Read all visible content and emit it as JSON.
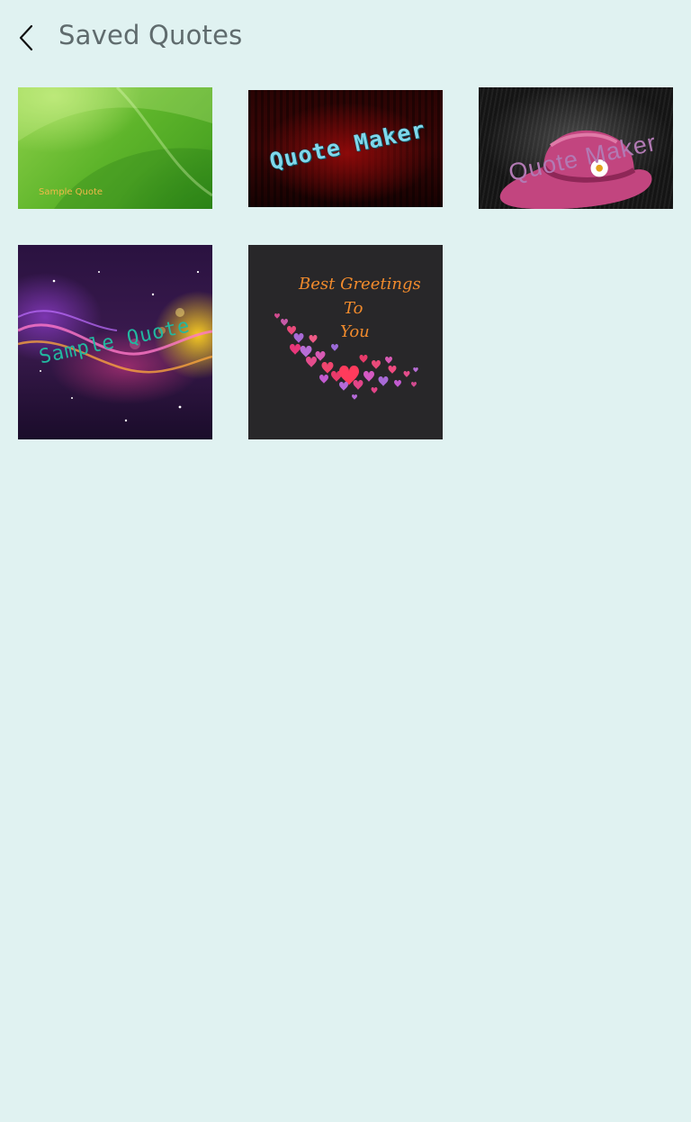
{
  "header": {
    "title": "Saved Quotes"
  },
  "cards": [
    {
      "text": "Sample Quote",
      "background": "green"
    },
    {
      "text": "Quote Maker",
      "background": "dark red"
    },
    {
      "text": "Quote Maker",
      "background": "dark wood"
    },
    {
      "text": "Sample Quote",
      "background": "cosmic"
    },
    {
      "lines": [
        "Best Greetings",
        "To",
        "You"
      ],
      "background": "dark gray"
    }
  ],
  "colors": {
    "background": "#e0f2f1",
    "title": "#5f6b6d"
  },
  "icons": {
    "back": "chevron-left-icon",
    "emoji": "crowned-smiley-emoji",
    "hat": "pink-hat-illustration",
    "hearts": "hearts-illustration"
  }
}
